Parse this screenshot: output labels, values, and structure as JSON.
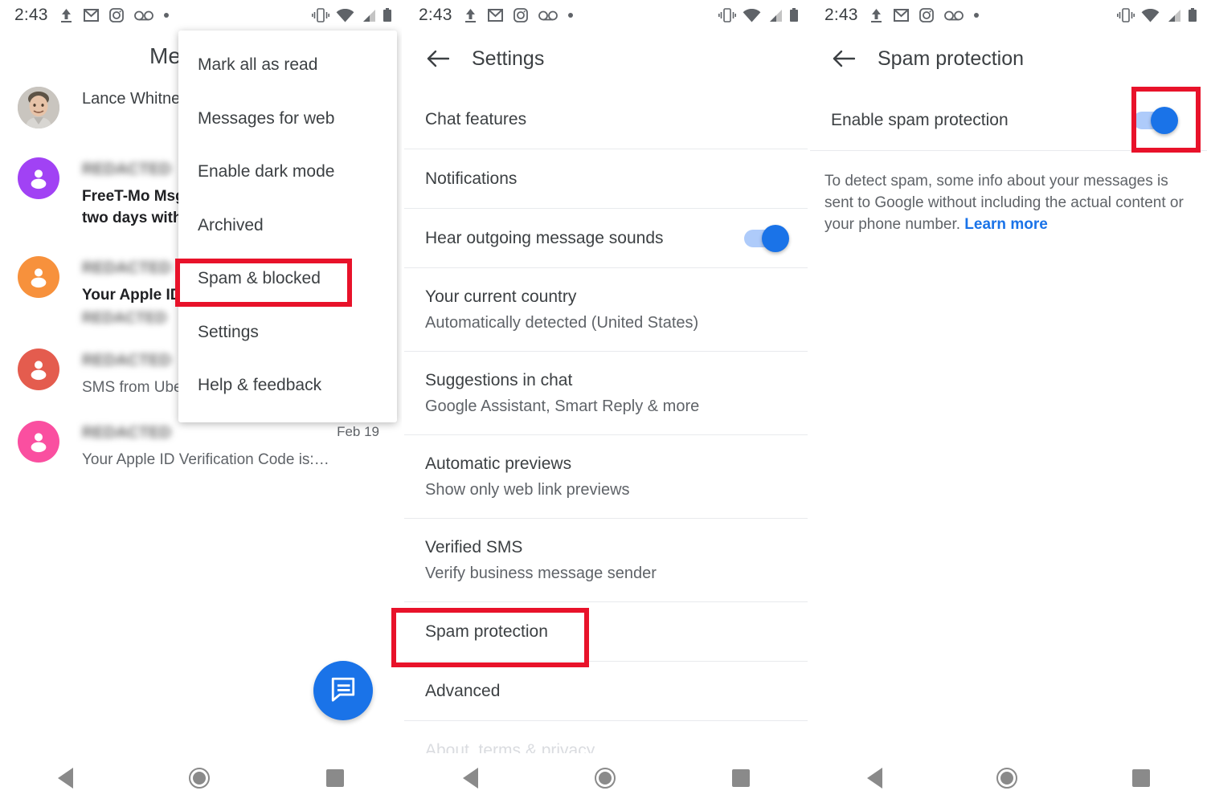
{
  "statusbar": {
    "time": "2:43",
    "left_icons": [
      "upload-icon",
      "gmail-icon",
      "instagram-icon",
      "voicemail-icon",
      "dot-icon"
    ],
    "right_icons": [
      "vibrate-icon",
      "wifi-icon",
      "signal-icon",
      "battery-icon"
    ]
  },
  "colors": {
    "accent_blue": "#1a73e8",
    "toggle_track": "#aecbfa",
    "highlight_red": "#e8122a",
    "text_primary": "#3c4043",
    "text_secondary": "#5f6368",
    "divider": "#e8eaed",
    "avatar_purple": "#a142f4",
    "avatar_orange": "#f7913c",
    "avatar_red": "#e45c4e",
    "avatar_pink": "#fa4fa0"
  },
  "panel_left": {
    "title": "Messages",
    "title_visible": "Me",
    "conversations": [
      {
        "avatar_type": "photo",
        "avatar_color": "#b7b3ae",
        "name": "Lance Whitney",
        "name_blurred": false,
        "snippet": "",
        "snippet_bold": false,
        "extra": "",
        "date": ""
      },
      {
        "avatar_type": "person",
        "avatar_color": "#a142f4",
        "name": "REDACTED",
        "name_blurred": true,
        "snippet": "FreeT-Mo Msg: Your plan will renew in two days with an estimated",
        "snippet_bold": true,
        "extra": "",
        "date": ""
      },
      {
        "avatar_type": "person",
        "avatar_color": "#f7913c",
        "name": "REDACTED",
        "name_blurred": true,
        "snippet": "Your Apple ID",
        "snippet_bold": true,
        "extra": "REDACTED",
        "date": ""
      },
      {
        "avatar_type": "person",
        "avatar_color": "#e45c4e",
        "name": "REDACTED",
        "name_blurred": true,
        "snippet": "SMS from Uber",
        "snippet_bold": false,
        "extra": "",
        "date": ""
      },
      {
        "avatar_type": "person",
        "avatar_color": "#fa4fa0",
        "name": "REDACTED",
        "name_blurred": true,
        "snippet": "Your Apple ID Verification Code is:…",
        "snippet_bold": false,
        "extra": "",
        "date": "Feb 19"
      }
    ],
    "fab": {
      "icon": "compose-message-icon",
      "color": "#1a73e8"
    },
    "menu": {
      "items": [
        {
          "label": "Mark all as read",
          "highlighted": false
        },
        {
          "label": "Messages for web",
          "highlighted": false
        },
        {
          "label": "Enable dark mode",
          "highlighted": false
        },
        {
          "label": "Archived",
          "highlighted": false
        },
        {
          "label": "Spam & blocked",
          "highlighted": true
        },
        {
          "label": "Settings",
          "highlighted": false
        },
        {
          "label": "Help & feedback",
          "highlighted": false
        }
      ]
    }
  },
  "panel_mid": {
    "header": {
      "title": "Settings",
      "back_icon": "back-arrow-icon"
    },
    "rows": [
      {
        "title": "Chat features",
        "sub": "",
        "toggle": null,
        "highlighted": false,
        "faded": false
      },
      {
        "title": "Notifications",
        "sub": "",
        "toggle": null,
        "highlighted": false,
        "faded": false
      },
      {
        "title": "Hear outgoing message sounds",
        "sub": "",
        "toggle": "on",
        "highlighted": false,
        "faded": false
      },
      {
        "title": "Your current country",
        "sub": "Automatically detected (United States)",
        "toggle": null,
        "highlighted": false,
        "faded": false
      },
      {
        "title": "Suggestions in chat",
        "sub": "Google Assistant, Smart Reply & more",
        "toggle": null,
        "highlighted": false,
        "faded": false
      },
      {
        "title": "Automatic previews",
        "sub": "Show only web link previews",
        "toggle": null,
        "highlighted": false,
        "faded": false
      },
      {
        "title": "Verified SMS",
        "sub": "Verify business message sender",
        "toggle": null,
        "highlighted": false,
        "faded": false
      },
      {
        "title": "Spam protection",
        "sub": "",
        "toggle": null,
        "highlighted": true,
        "faded": false
      },
      {
        "title": "Advanced",
        "sub": "",
        "toggle": null,
        "highlighted": false,
        "faded": false
      },
      {
        "title": "About, terms & privacy",
        "sub": "",
        "toggle": null,
        "highlighted": false,
        "faded": true
      }
    ]
  },
  "panel_right": {
    "header": {
      "title": "Spam protection",
      "back_icon": "back-arrow-icon"
    },
    "toggle_row": {
      "label": "Enable spam protection",
      "toggle": "on",
      "highlighted": true
    },
    "description": {
      "text": "To detect spam, some info about your messages is sent to Google without including the actual content or your phone number. ",
      "link": "Learn more"
    }
  },
  "navbar": {
    "buttons": [
      "back-triangle-icon",
      "home-circle-icon",
      "recents-square-icon"
    ]
  }
}
